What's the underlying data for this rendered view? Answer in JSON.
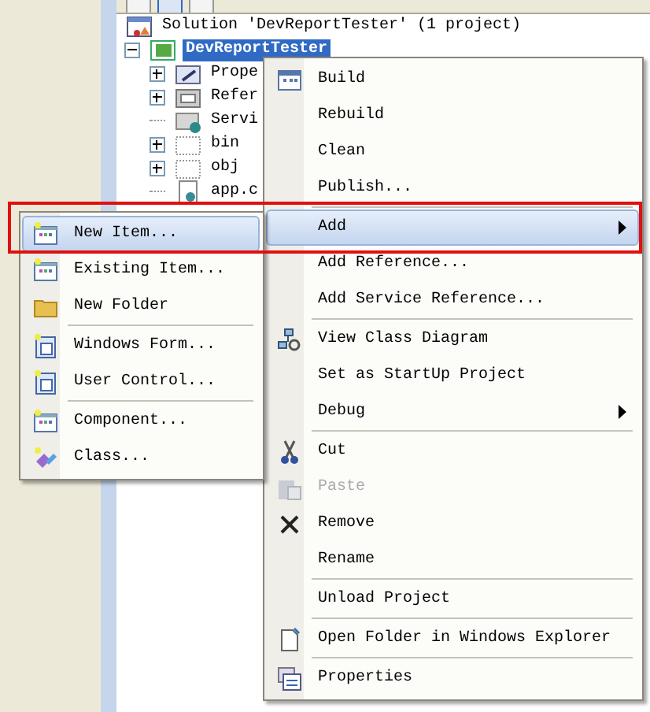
{
  "solution_explorer": {
    "solution": {
      "label": "Solution 'DevReportTester' (1 project)"
    },
    "project": {
      "label": "DevReportTester",
      "selected": true,
      "expanded": true,
      "children": [
        {
          "label": "Prope",
          "expandable": true
        },
        {
          "label": "Refer",
          "expandable": true
        },
        {
          "label": "Servi",
          "expandable": false
        },
        {
          "label": "bin",
          "expandable": true
        },
        {
          "label": "obj",
          "expandable": true
        },
        {
          "label": "app.c",
          "expandable": false
        }
      ]
    }
  },
  "context_menu": {
    "items": [
      {
        "kind": "item",
        "label": "Build",
        "selected": false,
        "disabled": false,
        "submenu": false
      },
      {
        "kind": "item",
        "label": "Rebuild",
        "selected": false,
        "disabled": false,
        "submenu": false
      },
      {
        "kind": "item",
        "label": "Clean",
        "selected": false,
        "disabled": false,
        "submenu": false
      },
      {
        "kind": "item",
        "label": "Publish...",
        "selected": false,
        "disabled": false,
        "submenu": false
      },
      {
        "kind": "separator"
      },
      {
        "kind": "item",
        "label": "Add",
        "selected": true,
        "disabled": false,
        "submenu": true
      },
      {
        "kind": "item",
        "label": "Add Reference...",
        "selected": false,
        "disabled": false,
        "submenu": false
      },
      {
        "kind": "item",
        "label": "Add Service Reference...",
        "selected": false,
        "disabled": false,
        "submenu": false
      },
      {
        "kind": "separator"
      },
      {
        "kind": "item",
        "label": "View Class Diagram",
        "selected": false,
        "disabled": false,
        "submenu": false
      },
      {
        "kind": "item",
        "label": "Set as StartUp Project",
        "selected": false,
        "disabled": false,
        "submenu": false
      },
      {
        "kind": "item",
        "label": "Debug",
        "selected": false,
        "disabled": false,
        "submenu": true
      },
      {
        "kind": "separator"
      },
      {
        "kind": "item",
        "label": "Cut",
        "selected": false,
        "disabled": false,
        "submenu": false
      },
      {
        "kind": "item",
        "label": "Paste",
        "selected": false,
        "disabled": true,
        "submenu": false
      },
      {
        "kind": "item",
        "label": "Remove",
        "selected": false,
        "disabled": false,
        "submenu": false
      },
      {
        "kind": "item",
        "label": "Rename",
        "selected": false,
        "disabled": false,
        "submenu": false
      },
      {
        "kind": "separator"
      },
      {
        "kind": "item",
        "label": "Unload Project",
        "selected": false,
        "disabled": false,
        "submenu": false
      },
      {
        "kind": "separator"
      },
      {
        "kind": "item",
        "label": "Open Folder in Windows Explorer",
        "selected": false,
        "disabled": false,
        "submenu": false
      },
      {
        "kind": "separator"
      },
      {
        "kind": "item",
        "label": "Properties",
        "selected": false,
        "disabled": false,
        "submenu": false
      }
    ]
  },
  "add_submenu": {
    "items": [
      {
        "kind": "item",
        "label": "New Item...",
        "selected": true,
        "disabled": false,
        "submenu": false
      },
      {
        "kind": "item",
        "label": "Existing Item...",
        "selected": false,
        "disabled": false,
        "submenu": false
      },
      {
        "kind": "item",
        "label": "New Folder",
        "selected": false,
        "disabled": false,
        "submenu": false
      },
      {
        "kind": "separator"
      },
      {
        "kind": "item",
        "label": "Windows Form...",
        "selected": false,
        "disabled": false,
        "submenu": false
      },
      {
        "kind": "item",
        "label": "User Control...",
        "selected": false,
        "disabled": false,
        "submenu": false
      },
      {
        "kind": "separator"
      },
      {
        "kind": "item",
        "label": "Component...",
        "selected": false,
        "disabled": false,
        "submenu": false
      },
      {
        "kind": "item",
        "label": "Class...",
        "selected": false,
        "disabled": false,
        "submenu": false
      }
    ]
  }
}
